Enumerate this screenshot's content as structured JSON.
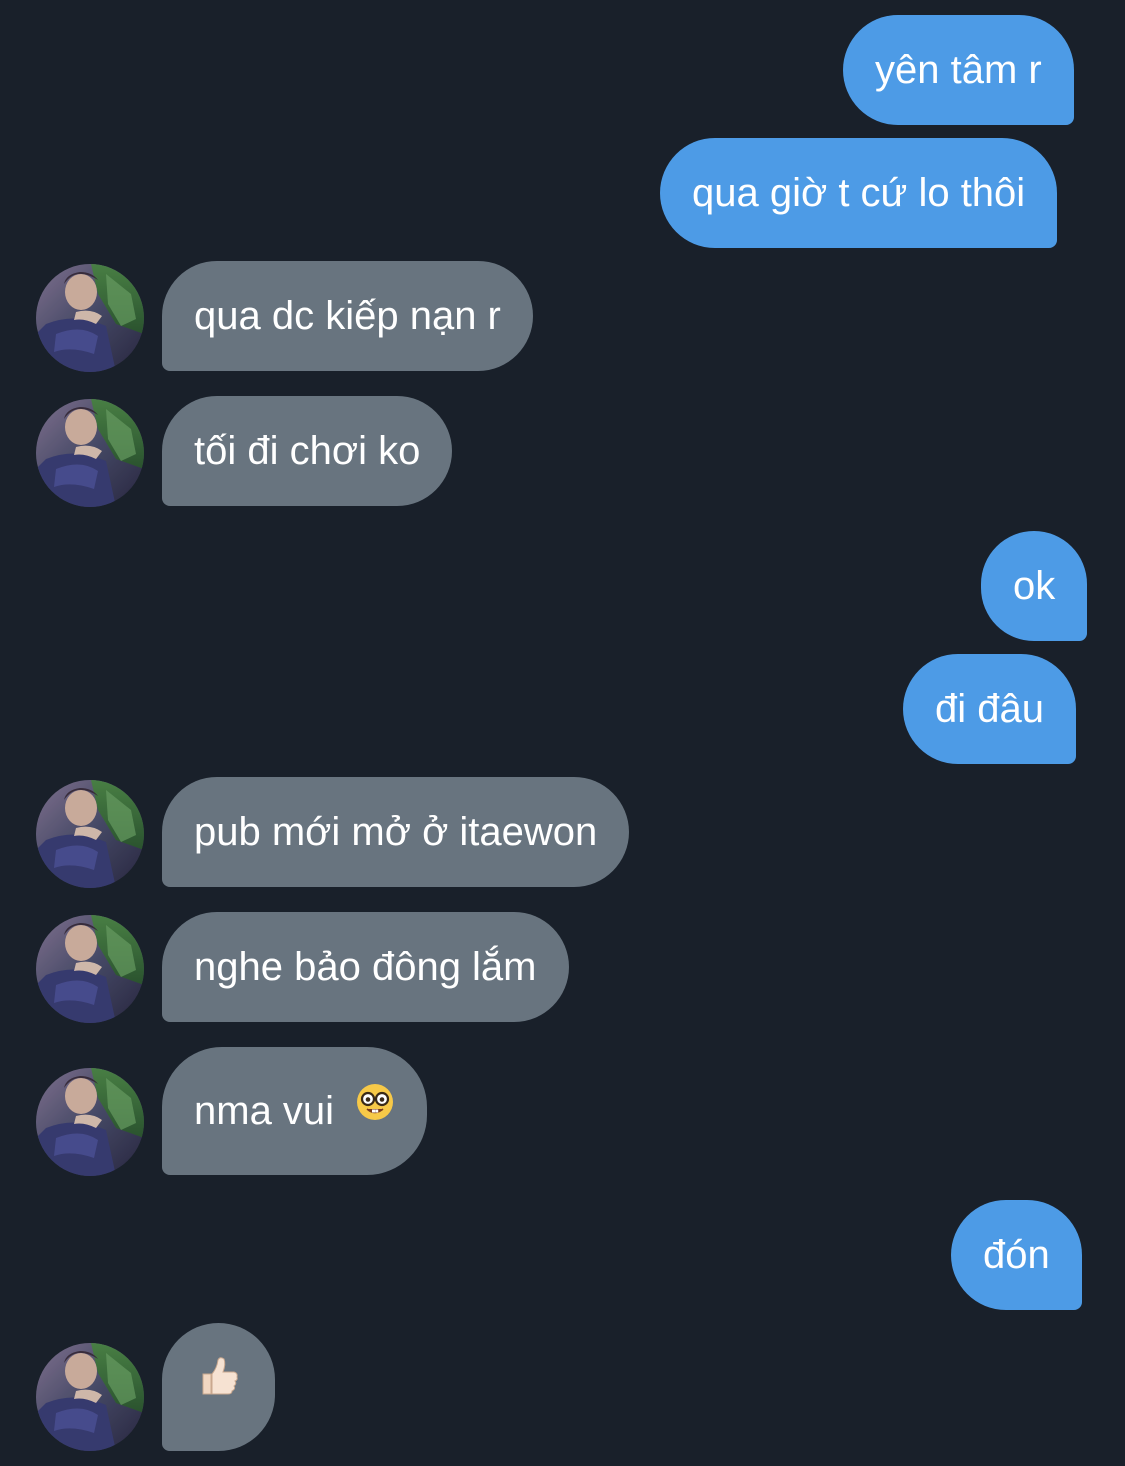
{
  "messages": [
    {
      "direction": "outgoing",
      "text": "yên tâm r"
    },
    {
      "direction": "outgoing",
      "text": "qua giờ t cứ lo thôi"
    },
    {
      "direction": "incoming",
      "text": "qua dc kiếp nạn r"
    },
    {
      "direction": "incoming",
      "text": "tối đi chơi ko"
    },
    {
      "direction": "outgoing",
      "text": "ok"
    },
    {
      "direction": "outgoing",
      "text": "đi đâu"
    },
    {
      "direction": "incoming",
      "text": "pub mới mở ở itaewon"
    },
    {
      "direction": "incoming",
      "text": "nghe bảo đông lắm"
    },
    {
      "direction": "incoming",
      "text": "nma vui",
      "emoji": "nerd-face-icon"
    },
    {
      "direction": "outgoing",
      "text": "đón"
    },
    {
      "direction": "incoming",
      "text": "",
      "emoji": "thumbs-up-icon"
    }
  ],
  "colors": {
    "background": "#19202a",
    "outgoing_bubble": "#4d9be6",
    "incoming_bubble": "#68747f",
    "text": "#ffffff"
  },
  "contact": {
    "avatar": "contact-avatar"
  }
}
